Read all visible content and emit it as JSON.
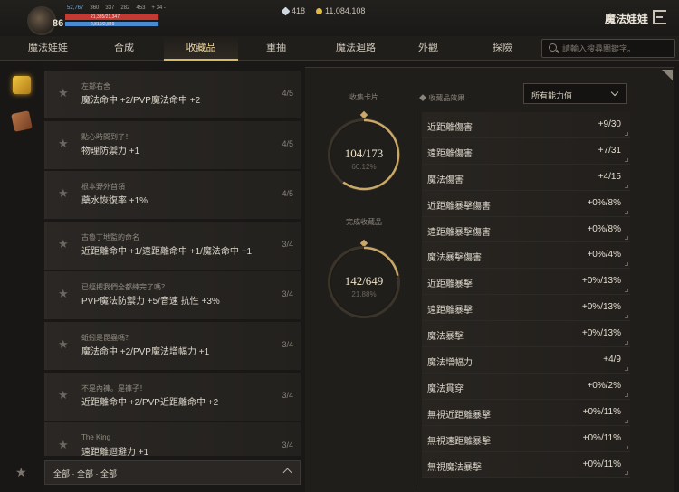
{
  "header": {
    "level": "86",
    "stats": [
      "52,767",
      "360",
      "337",
      "282",
      "453",
      "+ 34 -"
    ],
    "hp_text": "21,335/21,347",
    "mp_text": "2,810/2,849",
    "hp_fraction": 0.99,
    "mp_fraction": 0.99,
    "diamonds": "418",
    "gold": "11,084,108",
    "app_title": "魔法娃娃"
  },
  "nav": {
    "tabs": [
      "魔法娃娃",
      "合成",
      "收藏品",
      "重抽",
      "魔法迴路",
      "外觀",
      "探險"
    ],
    "active_index": 2,
    "search_placeholder": "請輸入搜尋關鍵字。"
  },
  "collection_list": [
    {
      "name": "左鄰右舍",
      "effect": "魔法命中 +2/PVP魔法命中 +2",
      "count": "4/5"
    },
    {
      "name": "點心時間到了！",
      "effect": "物理防禦力 +1",
      "count": "4/5"
    },
    {
      "name": "根本野外首領",
      "effect": "藥水恢復率 +1%",
      "count": "4/5"
    },
    {
      "name": "古魯丁地監的命名",
      "effect": "近距離命中 +1/遠距離命中 +1/魔法命中 +1",
      "count": "3/4"
    },
    {
      "name": "已經把我們全都練完了嗎？",
      "effect": "PVP魔法防禦力 +5/音速 抗性 +3%",
      "count": "3/4"
    },
    {
      "name": "蚯蚓是昆蟲嗎？",
      "effect": "魔法命中 +2/PVP魔法增幅力 +1",
      "count": "3/4"
    },
    {
      "name": "不是內褲。是褲子！",
      "effect": "近距離命中 +2/PVP近距離命中 +2",
      "count": "3/4"
    },
    {
      "name": "The King",
      "effect": "遠距離迴避力 +1",
      "count": "3/4"
    }
  ],
  "filter": {
    "label": "全部 · 全部 · 全部"
  },
  "progress": {
    "cards_title": "收集卡片",
    "cards_value": "104/173",
    "cards_pct": "60.12%",
    "cards_fraction": 0.6012,
    "done_title": "完成收藏品",
    "done_value": "142/649",
    "done_pct": "21.88%",
    "done_fraction": 0.2188
  },
  "effects": {
    "header": "收藏品效果",
    "dropdown_value": "所有能力值",
    "rows": [
      {
        "k": "近距離傷害",
        "v": "+9/30"
      },
      {
        "k": "遠距離傷害",
        "v": "+7/31"
      },
      {
        "k": "魔法傷害",
        "v": "+4/15"
      },
      {
        "k": "近距離暴擊傷害",
        "v": "+0%/8%"
      },
      {
        "k": "遠距離暴擊傷害",
        "v": "+0%/8%"
      },
      {
        "k": "魔法暴擊傷害",
        "v": "+0%/4%"
      },
      {
        "k": "近距離暴擊",
        "v": "+0%/13%"
      },
      {
        "k": "遠距離暴擊",
        "v": "+0%/13%"
      },
      {
        "k": "魔法暴擊",
        "v": "+0%/13%"
      },
      {
        "k": "魔法增幅力",
        "v": "+4/9"
      },
      {
        "k": "魔法貫穿",
        "v": "+0%/2%"
      },
      {
        "k": "無視近距離暴擊",
        "v": "+0%/11%"
      },
      {
        "k": "無視遠距離暴擊",
        "v": "+0%/11%"
      },
      {
        "k": "無視魔法暴擊",
        "v": "+0%/11%"
      }
    ]
  }
}
